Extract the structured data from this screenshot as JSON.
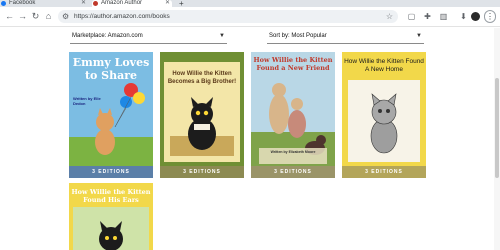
{
  "browser": {
    "tabs": [
      {
        "label": "Facebook"
      },
      {
        "label": "Amazon Author"
      }
    ],
    "new_tab": "+",
    "url": "https://author.amazon.com/books"
  },
  "filters": {
    "marketplace_label": "Marketplace: Amazon.com",
    "sort_label": "Sort by: Most Popular"
  },
  "books": [
    {
      "cover_title": "Emmy Loves to Share",
      "cover_byline": "Written by Elle Dedon",
      "editions": "3 EDITIONS",
      "cover_color": "#7ab8e0",
      "bar_color": "#5b7fa8"
    },
    {
      "cover_title": "How Willie the Kitten Becomes a Big Brother!",
      "cover_byline": "",
      "editions": "3 EDITIONS",
      "cover_color": "#7a9a3a",
      "bar_color": "#8c8a52"
    },
    {
      "cover_title": "How Willie the Kitten Found a New Friend",
      "cover_byline": "Written by Elizabeth Moore",
      "editions": "3 EDITIONS",
      "cover_color": "#e0d27a",
      "bar_color": "#9a9468"
    },
    {
      "cover_title": "How Willie the Kitten Found A New Home",
      "cover_byline": "",
      "editions": "3 EDITIONS",
      "cover_color": "#f0d84a",
      "bar_color": "#b3a55a"
    },
    {
      "cover_title": "How Willie the Kitten Found His Ears",
      "cover_byline": "",
      "editions": "",
      "cover_color": "#f0d84a",
      "bar_color": "#b3a55a"
    }
  ]
}
